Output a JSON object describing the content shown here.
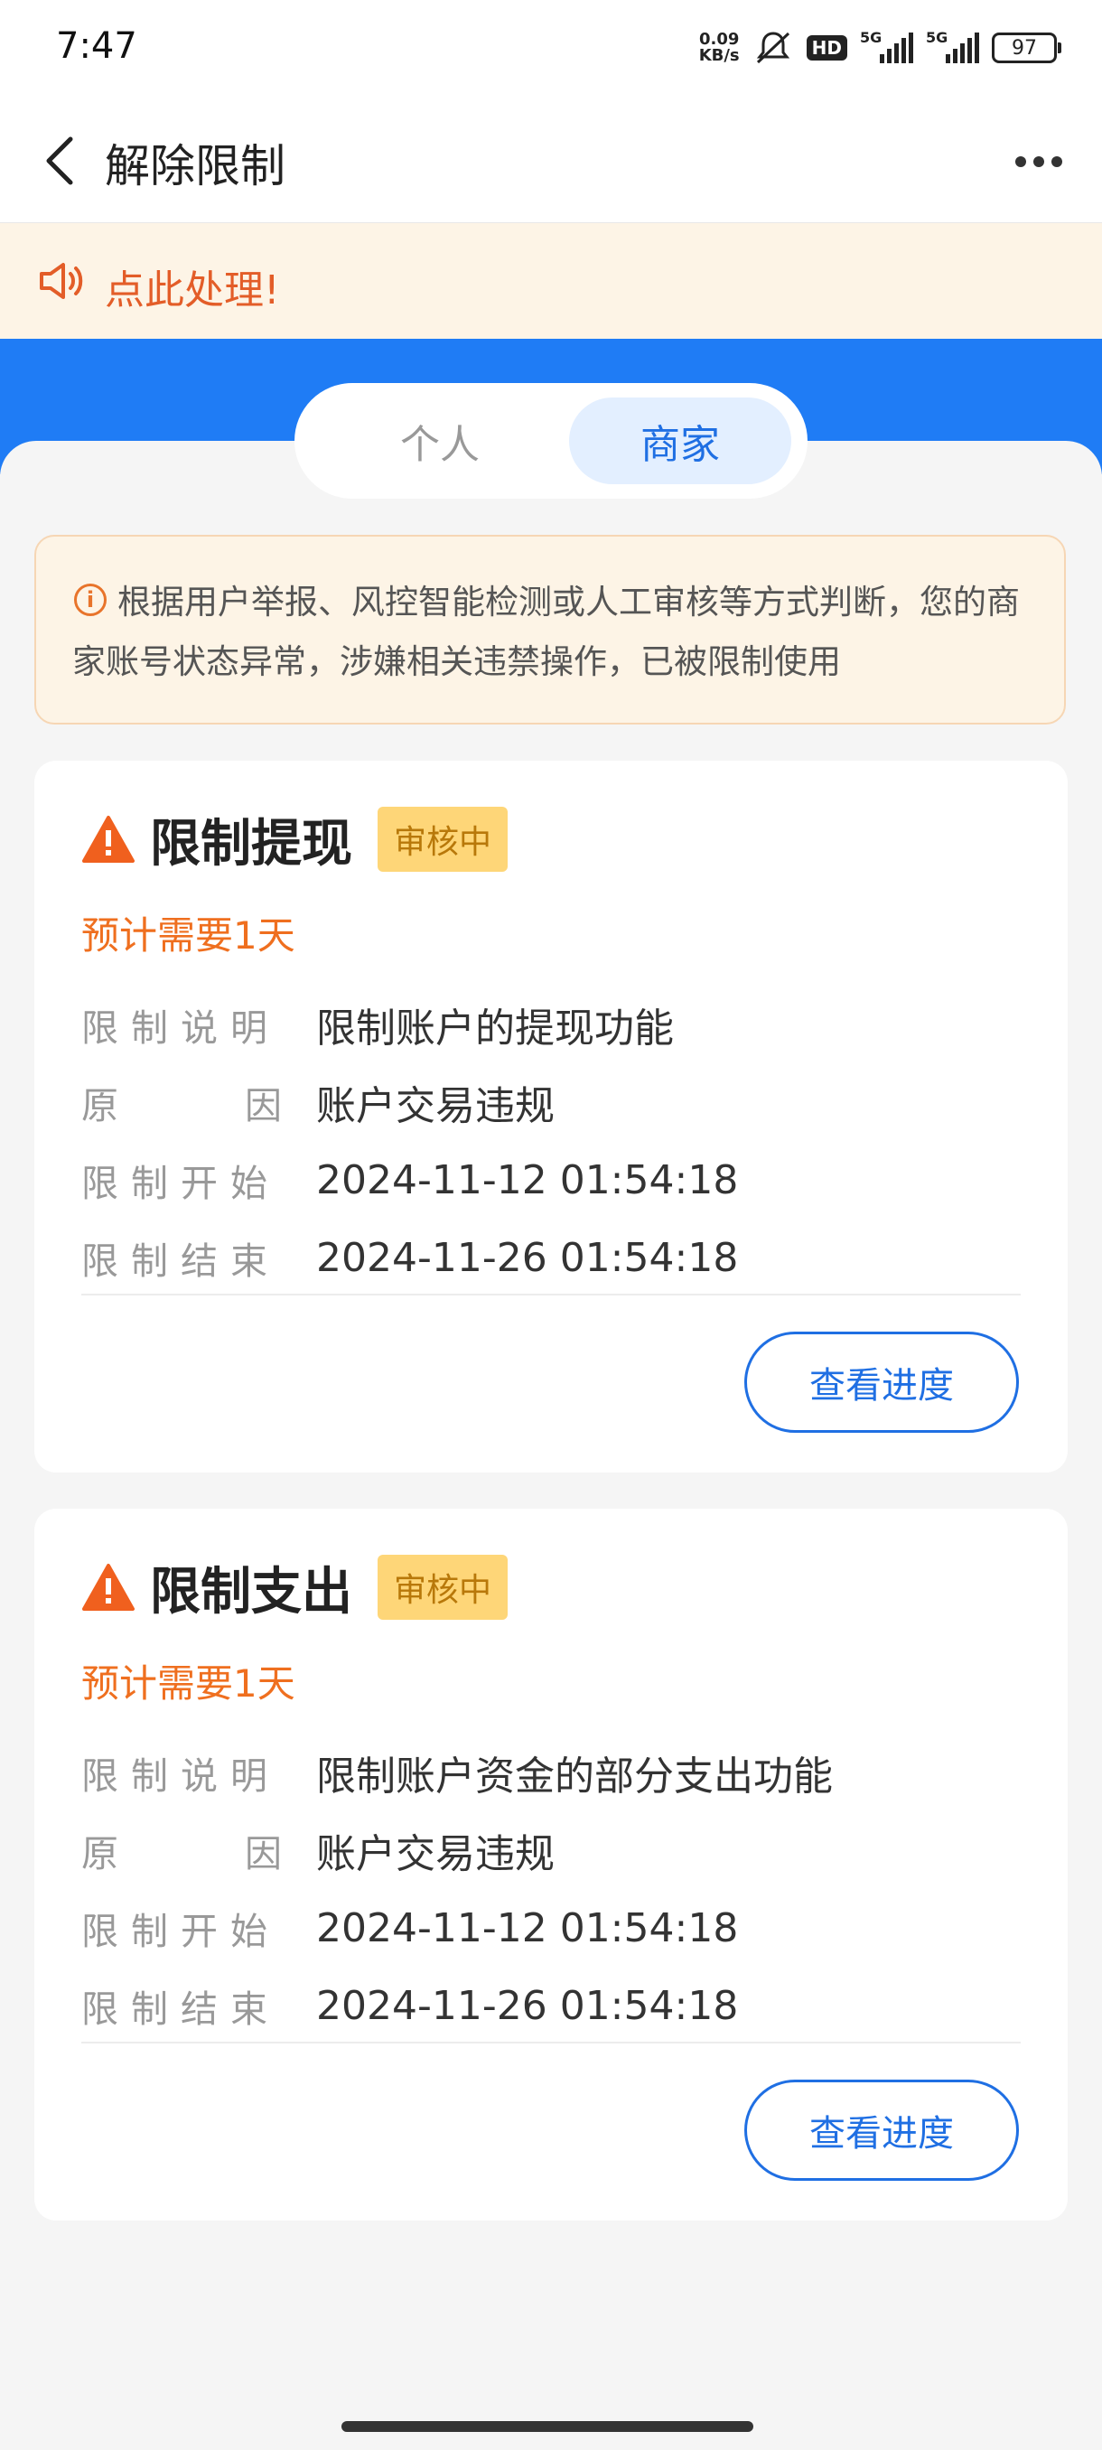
{
  "status_bar": {
    "time": "7:47",
    "net_speed_value": "0.09",
    "net_speed_unit": "KB/s",
    "hd_label": "HD",
    "signal_1_label": "5G",
    "signal_2_label": "5G",
    "battery": "97"
  },
  "nav": {
    "title": "解除限制"
  },
  "notice": {
    "text": "点此处理!"
  },
  "tabs": [
    {
      "label": "个人",
      "active": false
    },
    {
      "label": "商家",
      "active": true
    }
  ],
  "alert": {
    "text": "根据用户举报、风控智能检测或人工审核等方式判断，您的商家账号状态异常，涉嫌相关违禁操作，已被限制使用"
  },
  "cards": [
    {
      "title": "限制提现",
      "status_badge": "审核中",
      "eta": "预计需要1天",
      "rows": [
        {
          "label": "限制说明",
          "value": "限制账户的提现功能"
        },
        {
          "label_left": "原",
          "label_right": "因",
          "value": "账户交易违规"
        },
        {
          "label": "限制开始",
          "value": "2024-11-12 01:54:18"
        },
        {
          "label": "限制结束",
          "value": "2024-11-26 01:54:18"
        }
      ],
      "button_label": "查看进度"
    },
    {
      "title": "限制支出",
      "status_badge": "审核中",
      "eta": "预计需要1天",
      "rows": [
        {
          "label": "限制说明",
          "value": "限制账户资金的部分支出功能"
        },
        {
          "label_left": "原",
          "label_right": "因",
          "value": "账户交易违规"
        },
        {
          "label": "限制开始",
          "value": "2024-11-12 01:54:18"
        },
        {
          "label": "限制结束",
          "value": "2024-11-26 01:54:18"
        }
      ],
      "button_label": "查看进度"
    }
  ],
  "colors": {
    "brand_blue": "#1f7cf5",
    "accent_orange": "#ef6f1f",
    "badge_yellow": "#fed678"
  },
  "icons": [
    "chevron-left-icon",
    "more-dots-icon",
    "speaker-icon",
    "info-icon",
    "warning-icon"
  ]
}
